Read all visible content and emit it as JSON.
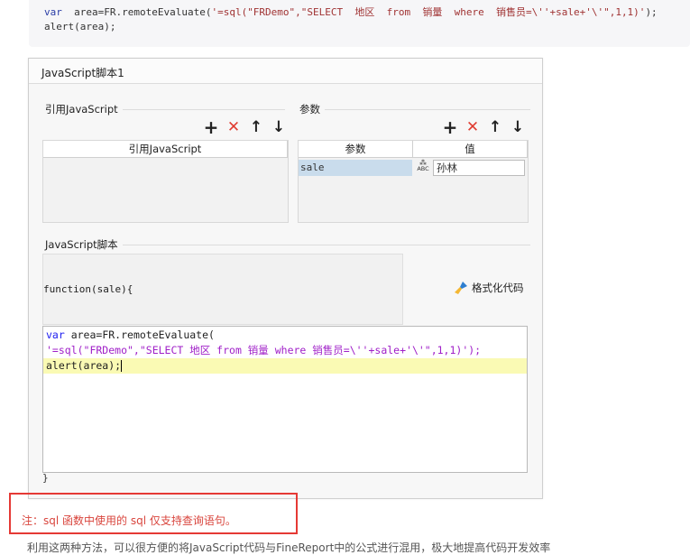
{
  "code_snippet": {
    "line1_kw": "var",
    "line1_rest": "  area=FR.remoteEvaluate(",
    "line1_str": "'=sql(\"FRDemo\",\"SELECT  地区  from  销量  where  销售员=\\''+sale+'\\'\",1,1)'",
    "line1_end": ");",
    "line2": "alert(area);"
  },
  "dialog": {
    "title": "JavaScript脚本1",
    "ref_js_section": "引用JavaScript",
    "params_section": "参数",
    "ref_js_column": "引用JavaScript",
    "param_columns": [
      "参数",
      "值"
    ],
    "param_row": {
      "name": "sale",
      "type_icon": "ABC",
      "value": "孙林"
    },
    "toolbar_icons": [
      "plus-icon",
      "delete-icon",
      "arrow-up-icon",
      "arrow-down-icon"
    ],
    "script_section": "JavaScript脚本",
    "function_signature": "function(sale){",
    "format_button": "格式化代码",
    "editor": {
      "l1_kw": "var",
      "l1_rest": " area=FR.remoteEvaluate(",
      "l2_str": "'=sql(\"FRDemo\",\"SELECT 地区 ",
      "l2_from": "from",
      "l2_mid": " 销量 ",
      "l2_where": "where",
      "l2_end": " 销售员=\\''+sale+'\\'\",1,1)');",
      "l3": "alert(area);"
    },
    "closing_brace": "}"
  },
  "note": "注：sql 函数中使用的 sql 仅支持查询语句。",
  "bottom_text": "利用这两种方法，可以很方便的将JavaScript代码与FineReport中的公式进行混用，极大地提高代码开发效率"
}
